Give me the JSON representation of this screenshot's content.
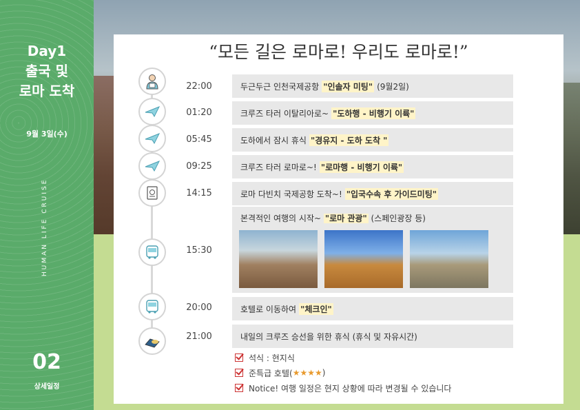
{
  "side": {
    "title_line1": "Day1",
    "title_line2": "출국 및",
    "title_line3": "로마 도착",
    "date": "9월 3일(수)",
    "vertical": "HUMAN LIFE CRUISE",
    "number": "02",
    "subtitle": "상세일정"
  },
  "title": "“모든 길은 로마로! 우리도 로마로!”",
  "schedule": [
    {
      "time": "22:00",
      "pre": "두근두근 인천국제공항",
      "highlight": "\"인솔자 미팅\"",
      "post": "(9월2일)",
      "icon": "guide-person-icon"
    },
    {
      "time": "01:20",
      "pre": "크루즈 타러 이탈리아로~",
      "highlight": "\"도하행 - 비행기 이륙\"",
      "post": "",
      "icon": "paper-plane-icon"
    },
    {
      "time": "05:45",
      "pre": "도하에서 잠시 휴식",
      "highlight": "\"경유지 - 도하 도착 \"",
      "post": "",
      "icon": "paper-plane-icon"
    },
    {
      "time": "09:25",
      "pre": "크루즈 타러 로마로~!",
      "highlight": "\"로마행 - 비행기 이륙\"",
      "post": "",
      "icon": "paper-plane-icon"
    },
    {
      "time": "14:15",
      "pre": "로마 다빈치 국제공항 도착~!",
      "highlight": "\"입국수속 후 가이드미팅\"",
      "post": "",
      "icon": "passport-icon"
    },
    {
      "time": "15:30",
      "pre": "본격적인 여행의 시작~",
      "highlight": "\"로마 관광\"",
      "post": "(스페인광장 등)",
      "icon": "bus-icon"
    },
    {
      "time": "20:00",
      "pre": "호텔로 이동하여",
      "highlight": "\"체크인\"",
      "post": "",
      "icon": "bus-icon"
    },
    {
      "time": "21:00",
      "pre": "내일의 크루즈 승선을 위한 휴식 (휴식 및 자유시간)",
      "highlight": "",
      "post": "",
      "icon": "bed-icon"
    }
  ],
  "notes": {
    "meal": "석식 : 현지식",
    "hotel_pre": "준특급 호텔(",
    "hotel_stars": "★★★★",
    "hotel_post": ")",
    "notice": "Notice!  여행 일정은 현지 상황에 따라 변경될 수 있습니다"
  },
  "colors": {
    "side_green": "#5aab6a",
    "highlight": "#fff4c8",
    "bar_gray": "#e8e8e8",
    "check_red": "#cc3333",
    "star_orange": "#e89a2e"
  }
}
